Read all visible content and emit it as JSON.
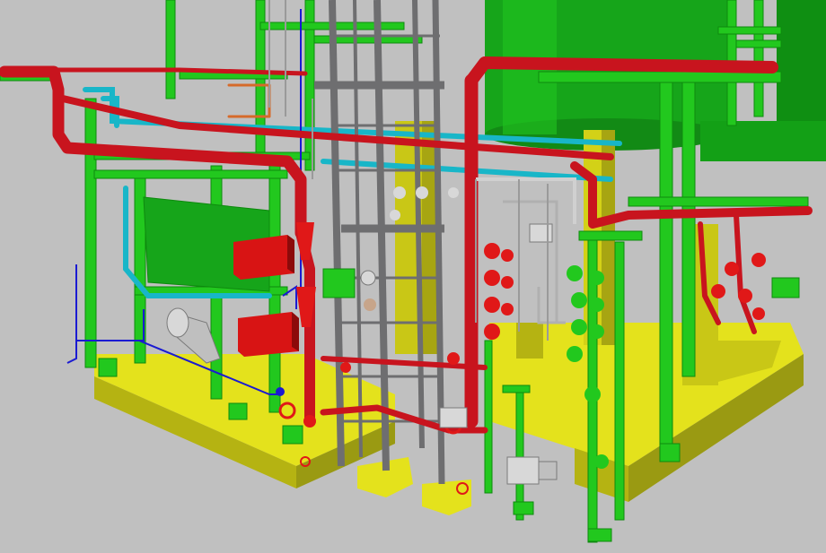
{
  "viewport": {
    "background": "#c0c0c0",
    "colors": {
      "structure_green": "#22c81e",
      "structure_dark_green": "#0e8a0e",
      "steam_pipe_red": "#c8141e",
      "valve_red": "#e01818",
      "cyan_pipe": "#18b6c8",
      "foundation_yellow": "#e4e21c",
      "foundation_dark_yellow": "#9a9a12",
      "ladder_gray": "#6e6e70",
      "instrument_blue": "#1a1ad2",
      "equipment_white": "#d8d8d8",
      "panel_red": "#d81414",
      "tank_green": "#16a51a"
    },
    "objects": [
      "storage-tank",
      "foundation-skid",
      "structural-frame",
      "steam-pipe-network",
      "cyan-pipe-network",
      "ladder-and-cage",
      "valve-cluster",
      "control-boxes",
      "pump-units",
      "instrument-lines"
    ]
  }
}
